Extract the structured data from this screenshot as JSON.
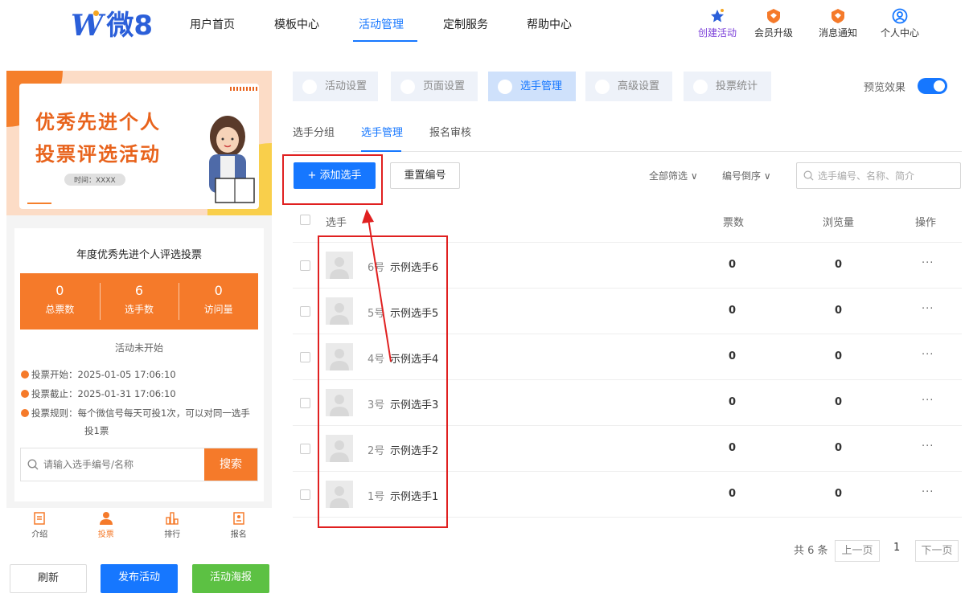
{
  "brand": {
    "logo_w": "W",
    "logo_text": "微8"
  },
  "nav": {
    "items": [
      "用户首页",
      "模板中心",
      "活动管理",
      "定制服务",
      "帮助中心"
    ],
    "active": "活动管理"
  },
  "header_right": [
    {
      "label": "创建活动",
      "icon": "create-activity-icon",
      "color": "#7b3fd9"
    },
    {
      "label": "会员升级",
      "icon": "member-upgrade-icon",
      "color": "#f57a2a"
    },
    {
      "label": "消息通知",
      "icon": "notification-icon",
      "color": "#f57a2a"
    },
    {
      "label": "个人中心",
      "icon": "user-center-icon",
      "color": "#1677ff"
    }
  ],
  "preview": {
    "banner": {
      "title_line1": "优秀先进个人",
      "title_line2": "投票评选活动",
      "time": "时间：XXXX"
    },
    "activity_title": "年度优秀先进个人评选投票",
    "stats": [
      {
        "value": "0",
        "label": "总票数"
      },
      {
        "value": "6",
        "label": "选手数"
      },
      {
        "value": "0",
        "label": "访问量"
      }
    ],
    "status": "活动未开始",
    "rules": [
      "投票开始：2025-01-05 17:06:10",
      "投票截止：2025-01-31 17:06:10",
      "投票规则：每个微信号每天可投1次，可以对同一选手"
    ],
    "rule_continuation": "投1票",
    "search_placeholder": "请输入选手编号/名称",
    "search_button": "搜索",
    "tabbar": [
      {
        "label": "介绍",
        "icon": "intro-icon"
      },
      {
        "label": "投票",
        "icon": "vote-user-icon"
      },
      {
        "label": "排行",
        "icon": "ranking-icon"
      },
      {
        "label": "报名",
        "icon": "signup-icon"
      }
    ],
    "tabbar_active": "投票"
  },
  "bottom_buttons": {
    "refresh": "刷新",
    "publish": "发布活动",
    "poster": "活动海报"
  },
  "top_tabs": [
    {
      "label": "活动设置",
      "icon": "activity-settings-icon"
    },
    {
      "label": "页面设置",
      "icon": "page-settings-icon"
    },
    {
      "label": "选手管理",
      "icon": "contestant-manage-icon"
    },
    {
      "label": "高级设置",
      "icon": "advanced-settings-icon"
    },
    {
      "label": "投票统计",
      "icon": "vote-stats-icon"
    }
  ],
  "top_tabs_active": "选手管理",
  "preview_toggle": {
    "label": "预览效果",
    "on": true
  },
  "sub_tabs": [
    "选手分组",
    "选手管理",
    "报名审核"
  ],
  "sub_tabs_active": "选手管理",
  "toolbar": {
    "add_label": "+ 添加选手",
    "renumber_label": "重置编号",
    "filter_all": "全部筛选 ∨",
    "sort_label": "编号倒序 ∨",
    "search_placeholder": "选手编号、名称、简介"
  },
  "table": {
    "headers": {
      "player": "选手",
      "votes": "票数",
      "views": "浏览量",
      "actions": "操作"
    },
    "rows": [
      {
        "num": "6号",
        "name": "示例选手6",
        "votes": "0",
        "views": "0",
        "more": "···"
      },
      {
        "num": "5号",
        "name": "示例选手5",
        "votes": "0",
        "views": "0",
        "more": "···"
      },
      {
        "num": "4号",
        "name": "示例选手4",
        "votes": "0",
        "views": "0",
        "more": "···"
      },
      {
        "num": "3号",
        "name": "示例选手3",
        "votes": "0",
        "views": "0",
        "more": "···"
      },
      {
        "num": "2号",
        "name": "示例选手2",
        "votes": "0",
        "views": "0",
        "more": "···"
      },
      {
        "num": "1号",
        "name": "示例选手1",
        "votes": "0",
        "views": "0",
        "more": "···"
      }
    ]
  },
  "pagination": {
    "total": "共 6 条",
    "prev": "上一页",
    "page": "1",
    "next": "下一页"
  },
  "colors": {
    "primary": "#1677ff",
    "orange": "#f57a2a",
    "green": "#5cc143",
    "annotation_red": "#e02020"
  }
}
